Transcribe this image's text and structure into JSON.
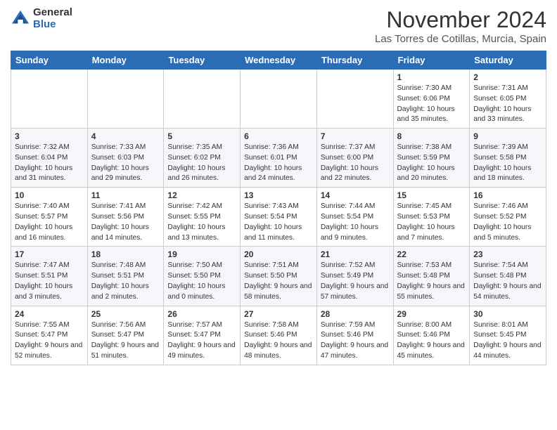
{
  "logo": {
    "general": "General",
    "blue": "Blue"
  },
  "header": {
    "month": "November 2024",
    "location": "Las Torres de Cotillas, Murcia, Spain"
  },
  "days_of_week": [
    "Sunday",
    "Monday",
    "Tuesday",
    "Wednesday",
    "Thursday",
    "Friday",
    "Saturday"
  ],
  "weeks": [
    [
      {
        "day": "",
        "info": ""
      },
      {
        "day": "",
        "info": ""
      },
      {
        "day": "",
        "info": ""
      },
      {
        "day": "",
        "info": ""
      },
      {
        "day": "",
        "info": ""
      },
      {
        "day": "1",
        "info": "Sunrise: 7:30 AM\nSunset: 6:06 PM\nDaylight: 10 hours and 35 minutes."
      },
      {
        "day": "2",
        "info": "Sunrise: 7:31 AM\nSunset: 6:05 PM\nDaylight: 10 hours and 33 minutes."
      }
    ],
    [
      {
        "day": "3",
        "info": "Sunrise: 7:32 AM\nSunset: 6:04 PM\nDaylight: 10 hours and 31 minutes."
      },
      {
        "day": "4",
        "info": "Sunrise: 7:33 AM\nSunset: 6:03 PM\nDaylight: 10 hours and 29 minutes."
      },
      {
        "day": "5",
        "info": "Sunrise: 7:35 AM\nSunset: 6:02 PM\nDaylight: 10 hours and 26 minutes."
      },
      {
        "day": "6",
        "info": "Sunrise: 7:36 AM\nSunset: 6:01 PM\nDaylight: 10 hours and 24 minutes."
      },
      {
        "day": "7",
        "info": "Sunrise: 7:37 AM\nSunset: 6:00 PM\nDaylight: 10 hours and 22 minutes."
      },
      {
        "day": "8",
        "info": "Sunrise: 7:38 AM\nSunset: 5:59 PM\nDaylight: 10 hours and 20 minutes."
      },
      {
        "day": "9",
        "info": "Sunrise: 7:39 AM\nSunset: 5:58 PM\nDaylight: 10 hours and 18 minutes."
      }
    ],
    [
      {
        "day": "10",
        "info": "Sunrise: 7:40 AM\nSunset: 5:57 PM\nDaylight: 10 hours and 16 minutes."
      },
      {
        "day": "11",
        "info": "Sunrise: 7:41 AM\nSunset: 5:56 PM\nDaylight: 10 hours and 14 minutes."
      },
      {
        "day": "12",
        "info": "Sunrise: 7:42 AM\nSunset: 5:55 PM\nDaylight: 10 hours and 13 minutes."
      },
      {
        "day": "13",
        "info": "Sunrise: 7:43 AM\nSunset: 5:54 PM\nDaylight: 10 hours and 11 minutes."
      },
      {
        "day": "14",
        "info": "Sunrise: 7:44 AM\nSunset: 5:54 PM\nDaylight: 10 hours and 9 minutes."
      },
      {
        "day": "15",
        "info": "Sunrise: 7:45 AM\nSunset: 5:53 PM\nDaylight: 10 hours and 7 minutes."
      },
      {
        "day": "16",
        "info": "Sunrise: 7:46 AM\nSunset: 5:52 PM\nDaylight: 10 hours and 5 minutes."
      }
    ],
    [
      {
        "day": "17",
        "info": "Sunrise: 7:47 AM\nSunset: 5:51 PM\nDaylight: 10 hours and 3 minutes."
      },
      {
        "day": "18",
        "info": "Sunrise: 7:48 AM\nSunset: 5:51 PM\nDaylight: 10 hours and 2 minutes."
      },
      {
        "day": "19",
        "info": "Sunrise: 7:50 AM\nSunset: 5:50 PM\nDaylight: 10 hours and 0 minutes."
      },
      {
        "day": "20",
        "info": "Sunrise: 7:51 AM\nSunset: 5:50 PM\nDaylight: 9 hours and 58 minutes."
      },
      {
        "day": "21",
        "info": "Sunrise: 7:52 AM\nSunset: 5:49 PM\nDaylight: 9 hours and 57 minutes."
      },
      {
        "day": "22",
        "info": "Sunrise: 7:53 AM\nSunset: 5:48 PM\nDaylight: 9 hours and 55 minutes."
      },
      {
        "day": "23",
        "info": "Sunrise: 7:54 AM\nSunset: 5:48 PM\nDaylight: 9 hours and 54 minutes."
      }
    ],
    [
      {
        "day": "24",
        "info": "Sunrise: 7:55 AM\nSunset: 5:47 PM\nDaylight: 9 hours and 52 minutes."
      },
      {
        "day": "25",
        "info": "Sunrise: 7:56 AM\nSunset: 5:47 PM\nDaylight: 9 hours and 51 minutes."
      },
      {
        "day": "26",
        "info": "Sunrise: 7:57 AM\nSunset: 5:47 PM\nDaylight: 9 hours and 49 minutes."
      },
      {
        "day": "27",
        "info": "Sunrise: 7:58 AM\nSunset: 5:46 PM\nDaylight: 9 hours and 48 minutes."
      },
      {
        "day": "28",
        "info": "Sunrise: 7:59 AM\nSunset: 5:46 PM\nDaylight: 9 hours and 47 minutes."
      },
      {
        "day": "29",
        "info": "Sunrise: 8:00 AM\nSunset: 5:46 PM\nDaylight: 9 hours and 45 minutes."
      },
      {
        "day": "30",
        "info": "Sunrise: 8:01 AM\nSunset: 5:45 PM\nDaylight: 9 hours and 44 minutes."
      }
    ]
  ]
}
